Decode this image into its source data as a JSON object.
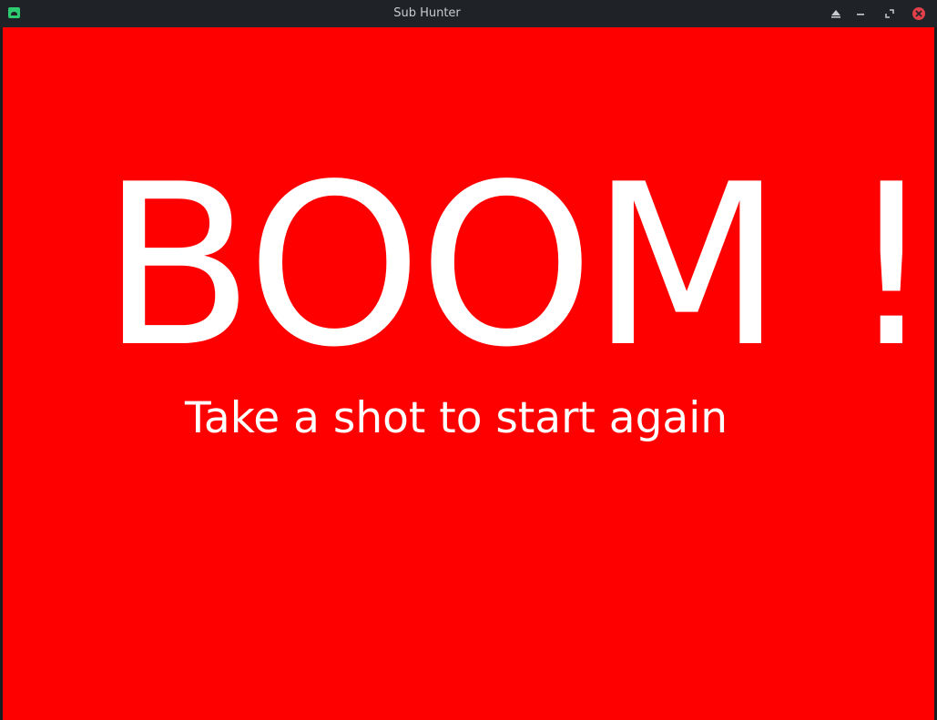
{
  "window": {
    "title": "Sub Hunter",
    "app_icon": "android-icon",
    "controls": [
      "keep-above-icon",
      "minimize-icon",
      "maximize-icon",
      "close-icon"
    ],
    "close_color": "#e0404a"
  },
  "game": {
    "background_color": "#ff0000",
    "text_color": "#ffffff",
    "headline": "BOOM !",
    "subtitle": "Take a shot to start again"
  }
}
